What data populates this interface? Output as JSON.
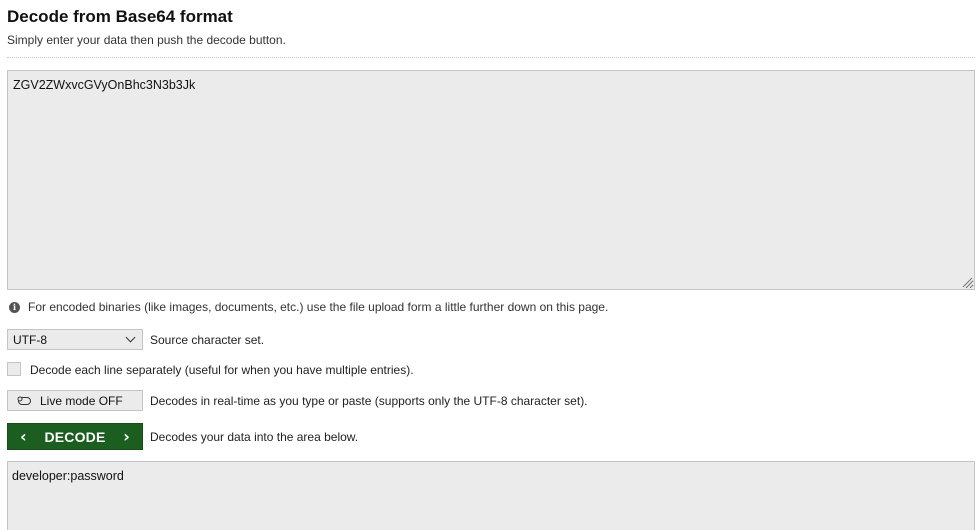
{
  "header": {
    "title": "Decode from Base64 format",
    "subtitle": "Simply enter your data then push the decode button."
  },
  "input": {
    "value": "ZGV2ZWxvcGVyOnBhc3N3b3Jk"
  },
  "info": {
    "icon": "info-icon",
    "text": "For encoded binaries (like images, documents, etc.) use the file upload form a little further down on this page."
  },
  "charset": {
    "selected": "UTF-8",
    "label": "Source character set."
  },
  "line_option": {
    "checked": false,
    "label": "Decode each line separately (useful for when you have multiple entries)."
  },
  "live_mode": {
    "button_label": "Live mode OFF",
    "description": "Decodes in real-time as you type or paste (supports only the UTF-8 character set)."
  },
  "decode": {
    "button_label": "DECODE",
    "description": "Decodes your data into the area below.",
    "color": "#1b5e20"
  },
  "output": {
    "value": "developer:password"
  }
}
